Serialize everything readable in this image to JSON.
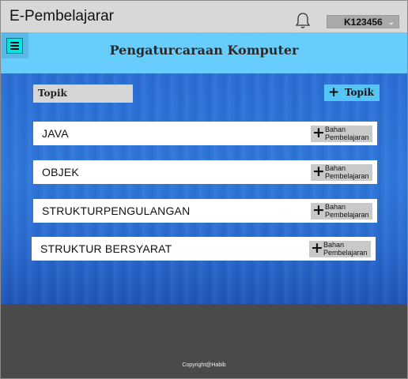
{
  "app": {
    "title": "E-Pembelajarar"
  },
  "user": {
    "selected": "K123456"
  },
  "course": {
    "title": "Pengaturcaraan Komputer"
  },
  "topics_section": {
    "label": "Topik",
    "add_label": "Topik"
  },
  "topics": [
    {
      "name": "JAVA",
      "action_line1": "Bahan",
      "action_line2": "Pembelajaran"
    },
    {
      "name": "OBJEK",
      "action_line1": "Bahan",
      "action_line2": "Pembelajaran"
    },
    {
      "name": "STRUKTURPENGULANGAN",
      "action_line1": "Bahan",
      "action_line2": "Pembelajaran"
    },
    {
      "name": "STRUKTUR BERSYARAT",
      "action_line1": "Bahan",
      "action_line2": "Pembelajaran"
    }
  ],
  "footer": {
    "copyright": "Copyright@Habib"
  },
  "icons": {
    "menu": "hamburger-icon",
    "notifications": "bell-icon",
    "dropdown": "chevron-down-icon",
    "add": "plus-icon"
  },
  "colors": {
    "header": "#66cdfc",
    "menu_button": "#00e7e7",
    "content_bg": "#2b6fd6",
    "footer": "#4a4a4a",
    "add_button": "#55c5f5"
  }
}
